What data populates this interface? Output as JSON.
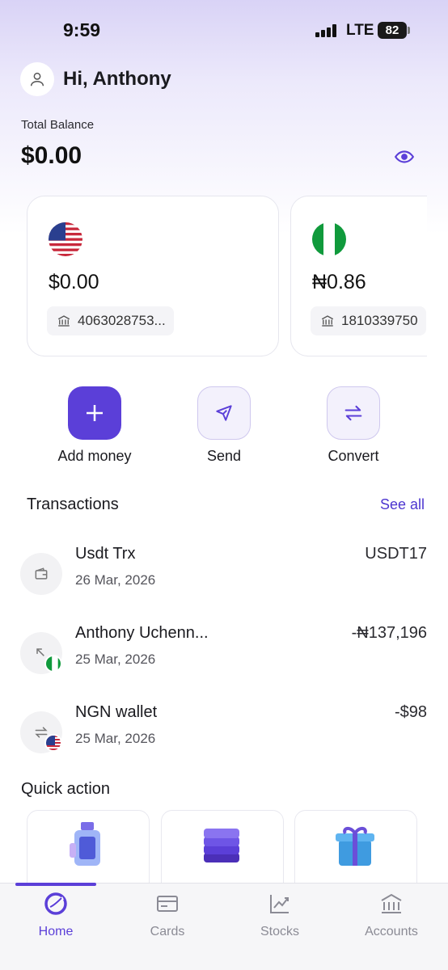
{
  "status_bar": {
    "time": "9:59",
    "network": "LTE",
    "battery": "82"
  },
  "header": {
    "greeting": "Hi, Anthony",
    "avatar_icon": "user-icon"
  },
  "balance": {
    "label": "Total Balance",
    "value": "$0.00",
    "visibility_icon": "eye-icon"
  },
  "accounts": [
    {
      "flag": "us-flag-icon",
      "amount": "$0.00",
      "account_number": "4063028753..."
    },
    {
      "flag": "ng-flag-icon",
      "amount": "₦0.86",
      "account_number": "1810339750"
    }
  ],
  "actions": [
    {
      "label": "Add money",
      "icon": "plus-icon"
    },
    {
      "label": "Send",
      "icon": "send-icon"
    },
    {
      "label": "Convert",
      "icon": "convert-icon"
    }
  ],
  "transactions": {
    "title": "Transactions",
    "see_all": "See all",
    "items": [
      {
        "name": "Usdt Trx",
        "date": "26 Mar, 2026",
        "amount": "USDT17",
        "icon": "wallet-icon"
      },
      {
        "name": "Anthony Uchenn...",
        "date": "25 Mar, 2026",
        "amount": "-₦137,196",
        "icon": "arrow-up-right-icon",
        "badge": "ng-flag-icon"
      },
      {
        "name": "NGN wallet",
        "date": "25 Mar, 2026",
        "amount": "-$98",
        "icon": "swap-icon",
        "badge": "us-flag-icon"
      }
    ]
  },
  "quick_action": {
    "title": "Quick action"
  },
  "tabs": [
    {
      "label": "Home",
      "icon": "home-icon",
      "active": true
    },
    {
      "label": "Cards",
      "icon": "card-icon",
      "active": false
    },
    {
      "label": "Stocks",
      "icon": "chart-icon",
      "active": false
    },
    {
      "label": "Accounts",
      "icon": "bank-icon",
      "active": false
    }
  ],
  "colors": {
    "accent": "#5b3fd8",
    "link": "#4d36d0",
    "tab_inactive": "#8b8b95"
  }
}
